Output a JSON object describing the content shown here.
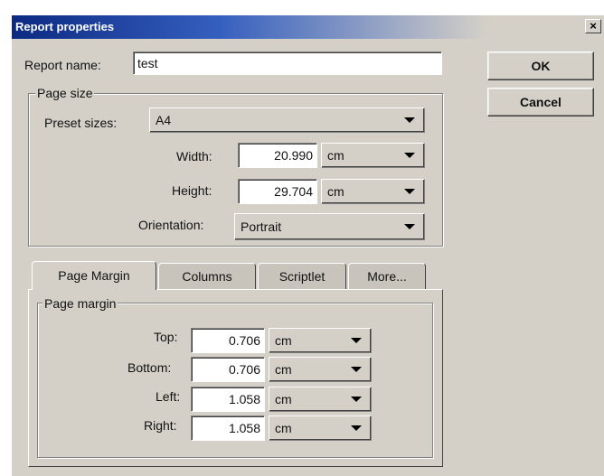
{
  "dialog": {
    "title": "Report properties",
    "close_glyph": "×",
    "ok_label": "OK",
    "cancel_label": "Cancel"
  },
  "report_name": {
    "label": "Report name:",
    "value": "test"
  },
  "page_size": {
    "group_label": "Page size",
    "preset_label": "Preset sizes:",
    "preset_value": "A4",
    "width_label": "Width:",
    "width_value": "20.990",
    "width_unit": "cm",
    "height_label": "Height:",
    "height_value": "29.704",
    "height_unit": "cm",
    "orientation_label": "Orientation:",
    "orientation_value": "Portrait"
  },
  "tabs": [
    {
      "label": "Page Margin",
      "active": true
    },
    {
      "label": "Columns",
      "active": false
    },
    {
      "label": "Scriptlet",
      "active": false
    },
    {
      "label": "More...",
      "active": false
    }
  ],
  "page_margin": {
    "group_label": "Page margin",
    "top_label": "Top:",
    "top_value": "0.706",
    "top_unit": "cm",
    "bottom_label": "Bottom:",
    "bottom_value": "0.706",
    "bottom_unit": "cm",
    "left_label": "Left:",
    "left_value": "1.058",
    "left_unit": "cm",
    "right_label": "Right:",
    "right_value": "1.058",
    "right_unit": "cm"
  },
  "icons": {
    "close": "close-icon",
    "dropdown": "chevron-down-icon"
  }
}
